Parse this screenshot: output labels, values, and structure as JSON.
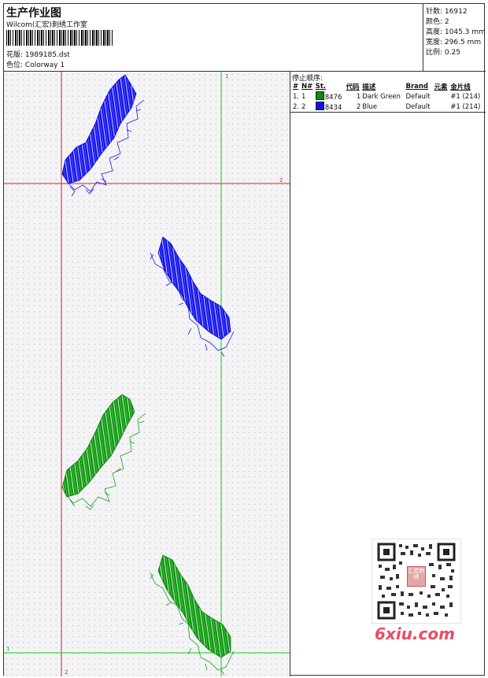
{
  "header": {
    "title": "生产作业图",
    "subtitle": "Wilcom(汇宏)刺绣工作室",
    "design_label": "花版:",
    "design_value": "1989185.dst",
    "colorway_label": "色位:",
    "colorway_value": "Colorway 1"
  },
  "stats": [
    {
      "label": "针数:",
      "value": "16912"
    },
    {
      "label": "颜色:",
      "value": "2"
    },
    {
      "label": "高度:",
      "value": "1045.3 mm"
    },
    {
      "label": "宽度:",
      "value": "296.5 mm"
    },
    {
      "label": "比例:",
      "value": "0.25"
    }
  ],
  "guides": {
    "h_top": "2",
    "v_top": "1",
    "h_bottom": "1",
    "v_bottom": "2"
  },
  "stop_sequence": {
    "title": "停止顺序:",
    "columns": [
      "#",
      "N#",
      "St.",
      "代码",
      "描述",
      "Brand",
      "元素",
      "金片线"
    ],
    "rows": [
      {
        "num": "1.",
        "n": "1",
        "color": "#118811",
        "st": "8476",
        "code": "1",
        "desc": "Dark Green",
        "brand": "Default",
        "elem": "",
        "seq": "#1 (214)"
      },
      {
        "num": "2.",
        "n": "2",
        "color": "#1010ee",
        "st": "8434",
        "code": "2",
        "desc": "Blue",
        "brand": "Default",
        "elem": "",
        "seq": "#1 (214)"
      }
    ]
  },
  "watermark": {
    "stamp": "汇宏刺绣",
    "site": "6xiu.com"
  }
}
